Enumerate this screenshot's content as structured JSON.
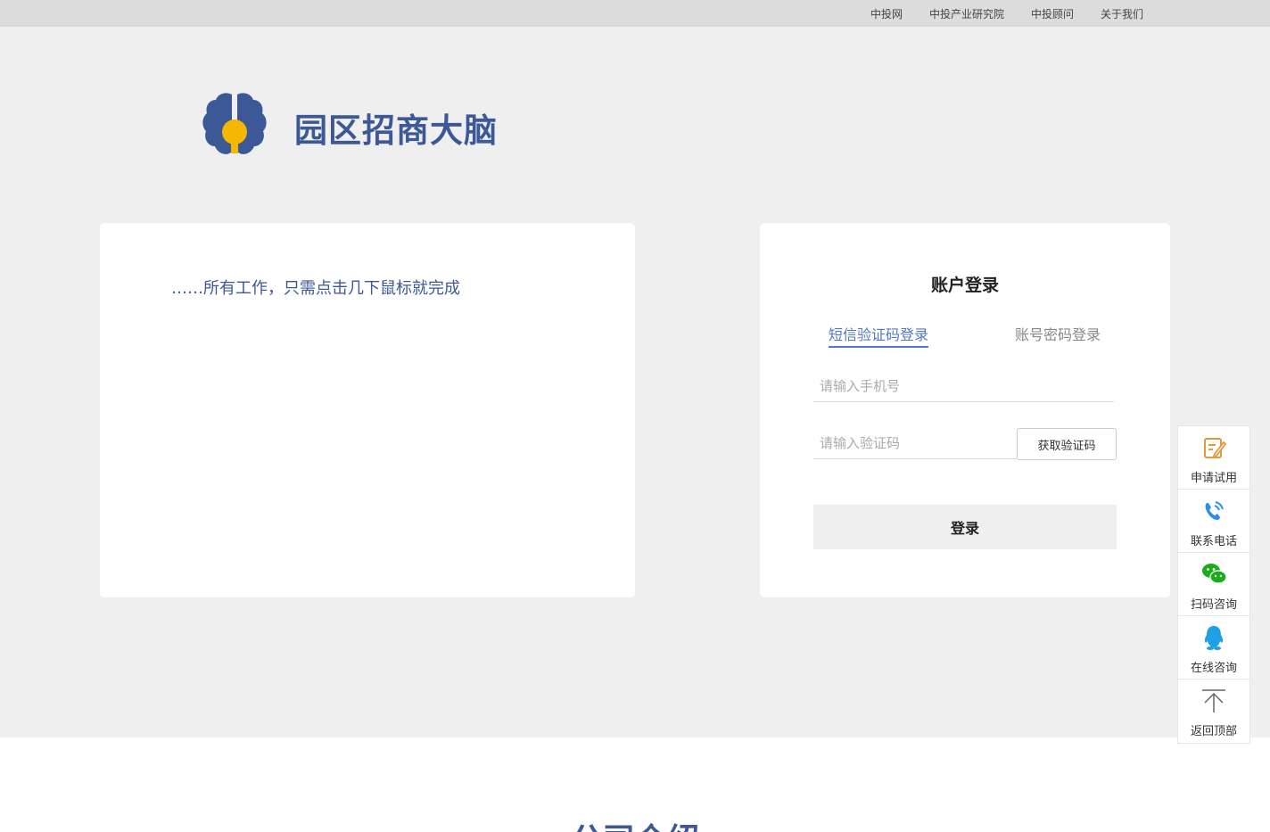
{
  "topnav": {
    "links": [
      "中投网",
      "中投产业研究院",
      "中投顾问",
      "关于我们"
    ]
  },
  "brand": {
    "title": "园区招商大脑",
    "logo_icon": "brain-lightbulb-icon",
    "color": "#3d5896",
    "accent": "#f5b700"
  },
  "intro": {
    "tagline": "……所有工作，只需点击几下鼠标就完成"
  },
  "login": {
    "title": "账户登录",
    "tabs": [
      {
        "label": "短信验证码登录",
        "active": true
      },
      {
        "label": "账号密码登录",
        "active": false
      }
    ],
    "phone_placeholder": "请输入手机号",
    "code_placeholder": "请输入验证码",
    "get_code_label": "获取验证码",
    "submit_label": "登录"
  },
  "sidebar": {
    "items": [
      {
        "label": "申请试用",
        "icon": "edit-icon"
      },
      {
        "label": "联系电话",
        "icon": "phone-icon"
      },
      {
        "label": "扫码咨询",
        "icon": "wechat-icon"
      },
      {
        "label": "在线咨询",
        "icon": "qq-icon"
      },
      {
        "label": "返回顶部",
        "icon": "arrow-up-icon"
      }
    ]
  },
  "section": {
    "title": "公司介绍"
  }
}
